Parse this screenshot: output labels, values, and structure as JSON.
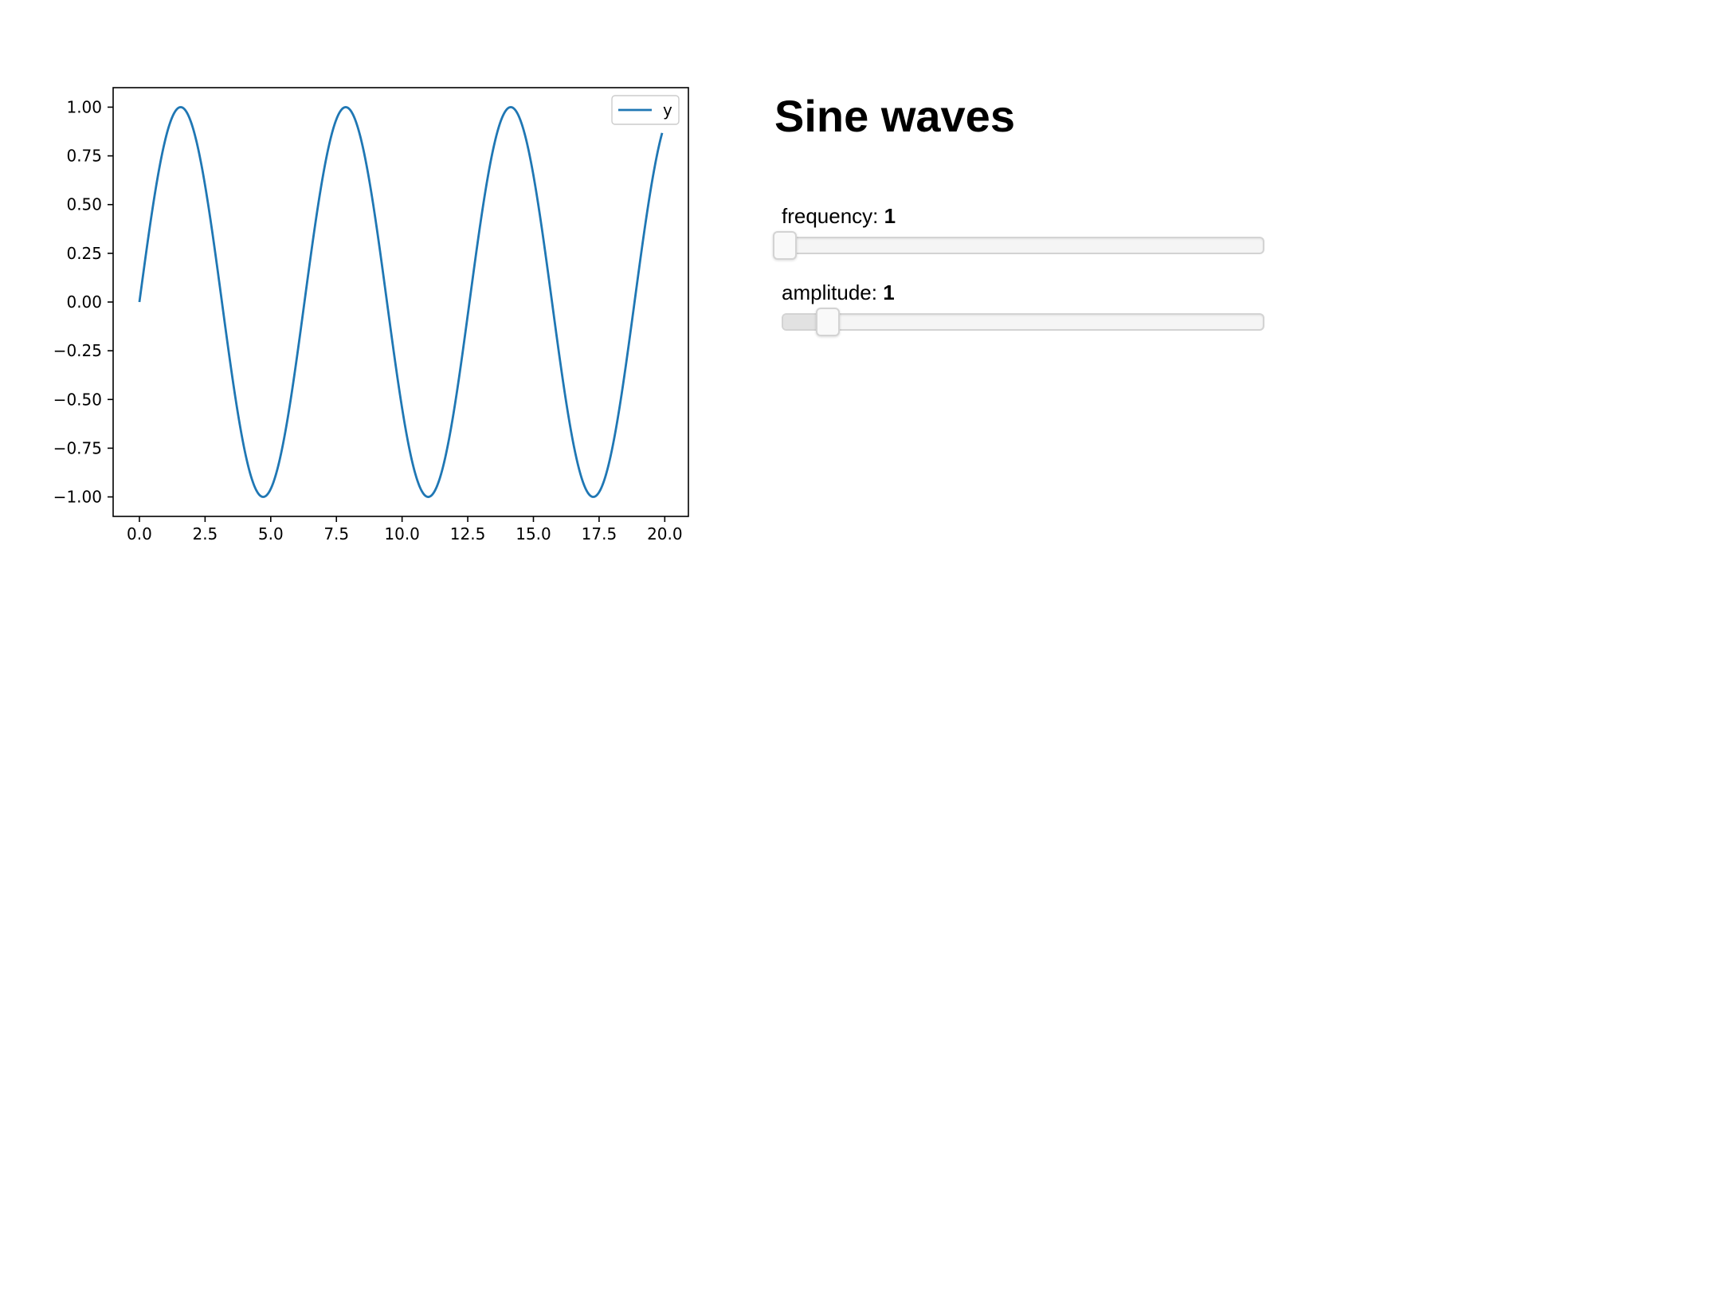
{
  "chart_data": {
    "type": "line",
    "function": "y = amplitude * sin(frequency * x)",
    "x_range": [
      0,
      19.9
    ],
    "xlim": [
      -1.0,
      20.9
    ],
    "ylim": [
      -1.1,
      1.1
    ],
    "xticks": [
      "0.0",
      "2.5",
      "5.0",
      "7.5",
      "10.0",
      "12.5",
      "15.0",
      "17.5",
      "20.0"
    ],
    "xtick_values": [
      0,
      2.5,
      5,
      7.5,
      10,
      12.5,
      15,
      17.5,
      20
    ],
    "yticks": [
      "−1.00",
      "−0.75",
      "−0.50",
      "−0.25",
      "0.00",
      "0.25",
      "0.50",
      "0.75",
      "1.00"
    ],
    "ytick_values": [
      -1,
      -0.75,
      -0.5,
      -0.25,
      0,
      0.25,
      0.5,
      0.75,
      1
    ],
    "series": [
      {
        "name": "y",
        "color": "#1f77b4"
      }
    ],
    "grid": false,
    "legend_position": "top-right",
    "title": "",
    "xlabel": "",
    "ylabel": ""
  },
  "page": {
    "title": "Sine waves"
  },
  "controls": {
    "frequency": {
      "label": "frequency:",
      "value": "1",
      "fraction": 0.0
    },
    "amplitude": {
      "label": "amplitude:",
      "value": "1",
      "fraction": 0.09
    }
  }
}
